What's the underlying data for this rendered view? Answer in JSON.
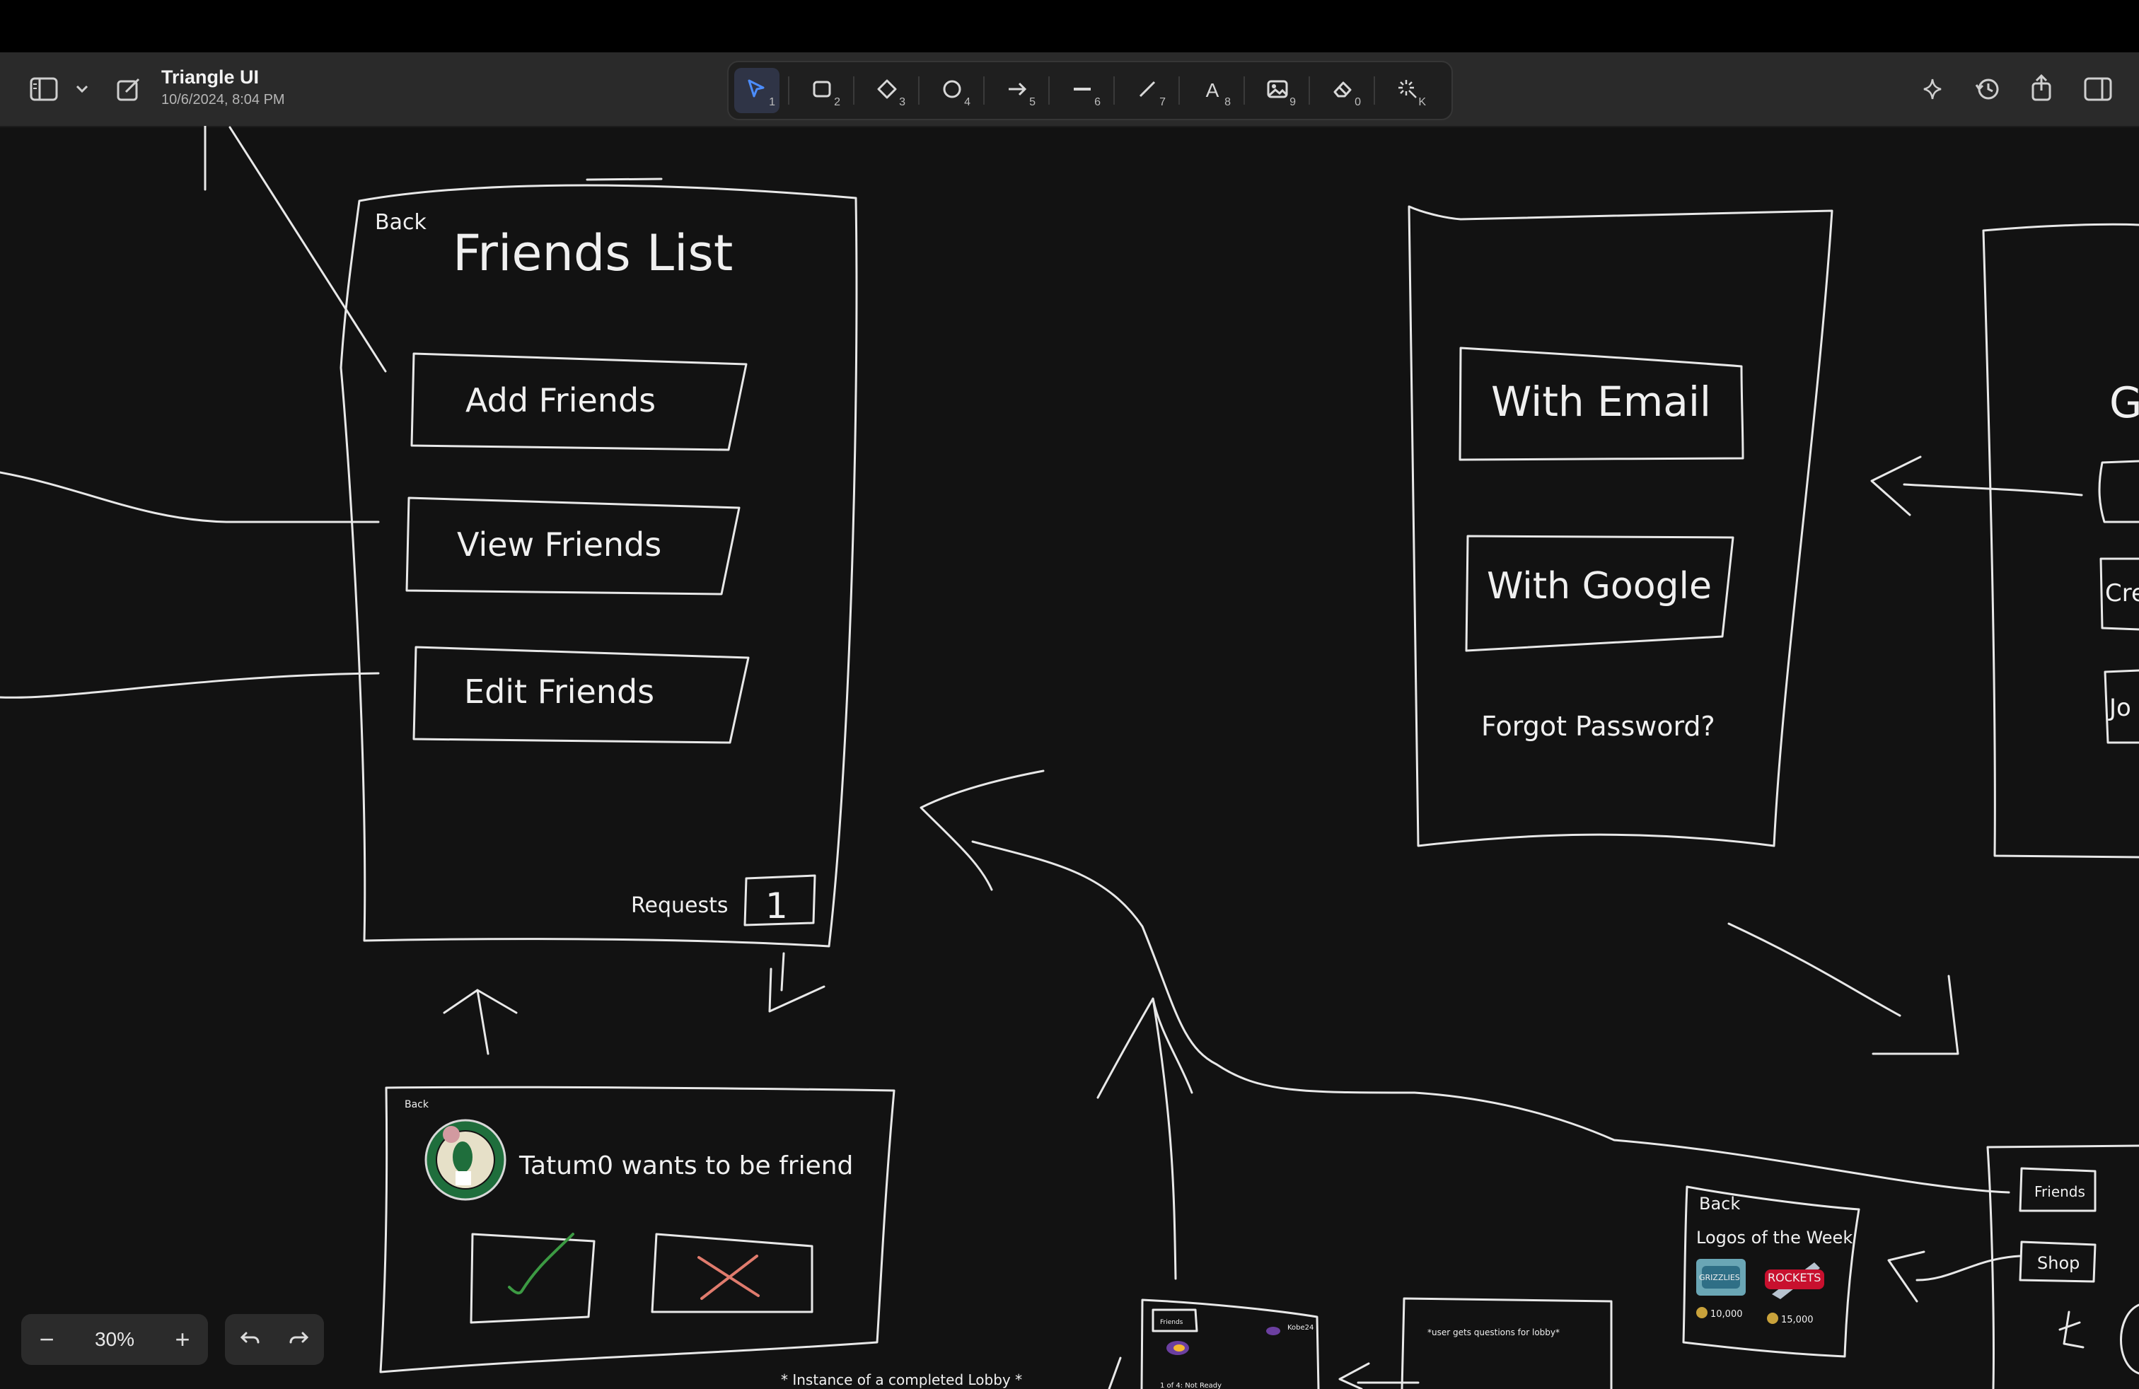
{
  "document": {
    "title": "Triangle UI",
    "date": "10/6/2024, 8:04 PM"
  },
  "toolbar": {
    "tools": [
      {
        "icon": "select-cursor-icon",
        "key": "1",
        "active": true
      },
      {
        "icon": "rectangle-icon",
        "key": "2"
      },
      {
        "icon": "diamond-icon",
        "key": "3"
      },
      {
        "icon": "ellipse-icon",
        "key": "4"
      },
      {
        "icon": "arrow-icon",
        "key": "5"
      },
      {
        "icon": "line-icon",
        "key": "6"
      },
      {
        "icon": "pencil-icon",
        "key": "7"
      },
      {
        "icon": "text-icon",
        "key": "8",
        "glyph": "A"
      },
      {
        "icon": "image-icon",
        "key": "9"
      },
      {
        "icon": "eraser-icon",
        "key": "0"
      },
      {
        "icon": "laser-icon",
        "key": "K"
      }
    ]
  },
  "colors": {
    "accent": "#4c8dff",
    "check": "#3c9a43",
    "cross": "#e07b6d",
    "canvas": "#121212",
    "stroke": "#e8e8e8"
  },
  "zoom": {
    "value": "30%",
    "minus": "−",
    "plus": "+"
  },
  "canvas": {
    "friends_list": {
      "back": "Back",
      "title": "Friends List",
      "add": "Add Friends",
      "view": "View Friends",
      "edit": "Edit Friends",
      "requests": "Requests",
      "requests_count": "1"
    },
    "login": {
      "email": "With Email",
      "google": "With Google",
      "forgot": "Forgot Password?"
    },
    "right_partial": {
      "g": "G",
      "cre": "Cre",
      "jo": "Jo"
    },
    "request_card": {
      "back": "Back",
      "text": "Tatum0 wants to be friend"
    },
    "logos": {
      "back": "Back",
      "title": "Logos of the Week",
      "price1": "10,000",
      "price2": "15,000",
      "logo1": "GRIZZLIES",
      "logo2": "ROCKETS"
    },
    "side_menu": {
      "friends": "Friends",
      "shop": "Shop"
    },
    "lobby": {
      "caption": "* Instance of a completed Lobby *",
      "friends": "Friends",
      "status": "1 of 4: Not Ready",
      "name": "Kobe24"
    },
    "questions": {
      "text": "*user gets questions for lobby*"
    }
  }
}
